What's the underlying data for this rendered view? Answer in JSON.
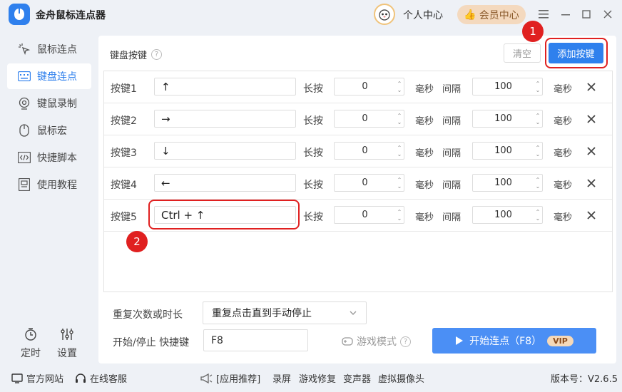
{
  "app": {
    "title": "金舟鼠标连点器",
    "personal_center": "个人中心",
    "vip_center": "会员中心"
  },
  "sidebar": {
    "items": [
      {
        "label": "鼠标连点",
        "icon": "mouse-click-icon"
      },
      {
        "label": "键盘连点",
        "icon": "keyboard-icon"
      },
      {
        "label": "键鼠录制",
        "icon": "record-icon"
      },
      {
        "label": "鼠标宏",
        "icon": "mouse-icon"
      },
      {
        "label": "快捷脚本",
        "icon": "script-icon"
      },
      {
        "label": "使用教程",
        "icon": "tutorial-icon"
      }
    ],
    "active_index": 1,
    "timer_label": "定时",
    "settings_label": "设置"
  },
  "panel": {
    "title": "键盘按键",
    "clear_label": "清空",
    "add_label": "添加按键",
    "long_press_label": "长按",
    "ms_label": "毫秒",
    "interval_label": "间隔",
    "rows": [
      {
        "label": "按键1",
        "key": "↑",
        "hold": "0",
        "interval": "100"
      },
      {
        "label": "按键2",
        "key": "→",
        "hold": "0",
        "interval": "100"
      },
      {
        "label": "按键3",
        "key": "↓",
        "hold": "0",
        "interval": "100"
      },
      {
        "label": "按键4",
        "key": "←",
        "hold": "0",
        "interval": "100"
      },
      {
        "label": "按键5",
        "key": "Ctrl + ↑",
        "hold": "0",
        "interval": "100"
      }
    ],
    "annotation_1": "1",
    "annotation_2": "2"
  },
  "options": {
    "repeat_label": "重复次数或时长",
    "repeat_value": "重复点击直到手动停止",
    "hotkey_label": "开始/停止 快捷键",
    "hotkey_value": "F8",
    "game_mode_label": "游戏模式",
    "start_label": "开始连点（F8）",
    "vip_tag": "VIP"
  },
  "footer": {
    "website": "官方网站",
    "support": "在线客服",
    "recommend": "[应用推荐]",
    "links": [
      "录屏",
      "游戏修复",
      "变声器",
      "虚拟摄像头"
    ],
    "version": "版本号：V2.6.5"
  },
  "colors": {
    "accent": "#2f80ed",
    "highlight": "#e02020",
    "vip_bg": "#f4d9be"
  }
}
